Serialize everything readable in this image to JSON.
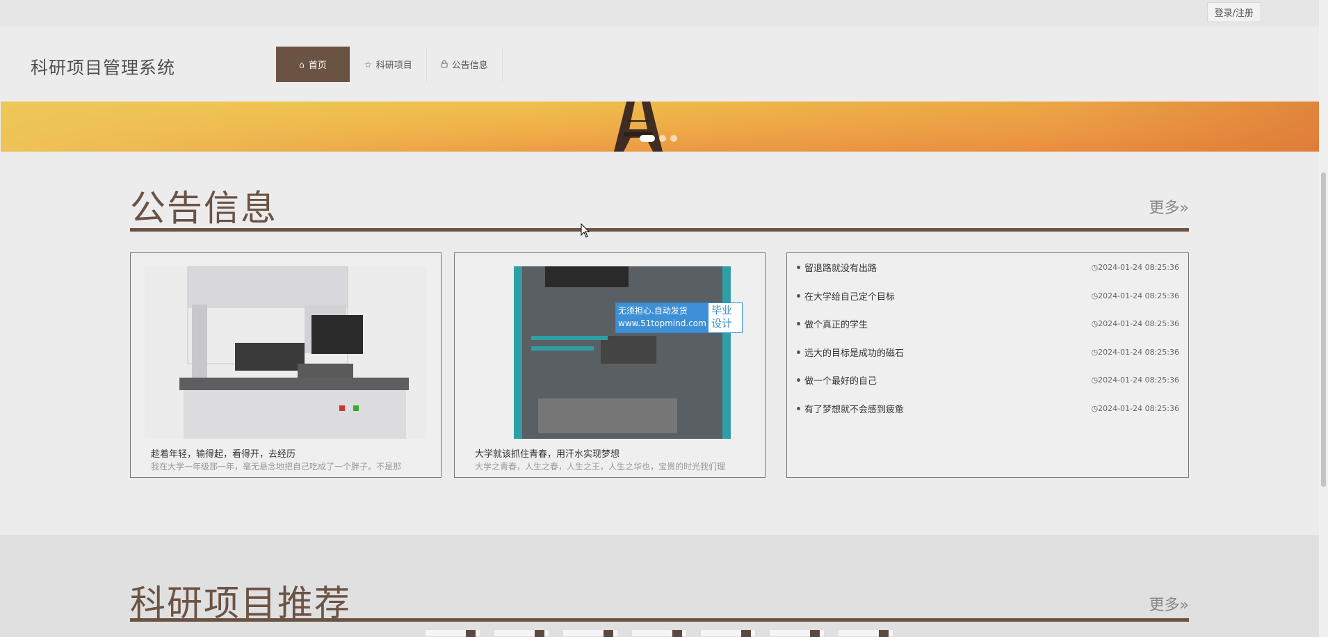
{
  "topbar": {
    "login_label": "登录/注册"
  },
  "header": {
    "site_title": "科研项目管理系统",
    "nav": [
      {
        "label": "首页",
        "icon": "home-icon"
      },
      {
        "label": "科研项目",
        "icon": "star-icon"
      },
      {
        "label": "公告信息",
        "icon": "lock-icon"
      }
    ]
  },
  "banner": {
    "slides": 3,
    "active_slide": 1
  },
  "notice_section": {
    "title": "公告信息",
    "more_label": "更多»",
    "cards": [
      {
        "title": "趁着年轻，输得起，看得开，去经历",
        "desc": "我在大学一年级那一年，毫无悬念地把自己吃成了一个胖子。不是那"
      },
      {
        "title": "大学就该抓住青春，用汗水实现梦想",
        "desc": "大学之青春，人生之春，人生之王，人生之华也，宝贵的时光我们理"
      }
    ],
    "watermark": {
      "line1": "无须担心.自动发货",
      "line2": "www.51topmind.com",
      "tag1": "毕业",
      "tag2": "设计"
    },
    "list": [
      {
        "title": "留退路就没有出路",
        "date": "2024-01-24 08:25:36"
      },
      {
        "title": "在大学给自己定个目标",
        "date": "2024-01-24 08:25:36"
      },
      {
        "title": "做个真正的学生",
        "date": "2024-01-24 08:25:36"
      },
      {
        "title": "远大的目标是成功的磁石",
        "date": "2024-01-24 08:25:36"
      },
      {
        "title": "做一个最好的自己",
        "date": "2024-01-24 08:25:36"
      },
      {
        "title": "有了梦想就不会感到疲惫",
        "date": "2024-01-24 08:25:36"
      }
    ]
  },
  "project_section": {
    "title": "科研项目推荐",
    "more_label": "更多»"
  },
  "colors": {
    "accent": "#6b5344",
    "banner_orange": "#f0a64a"
  }
}
